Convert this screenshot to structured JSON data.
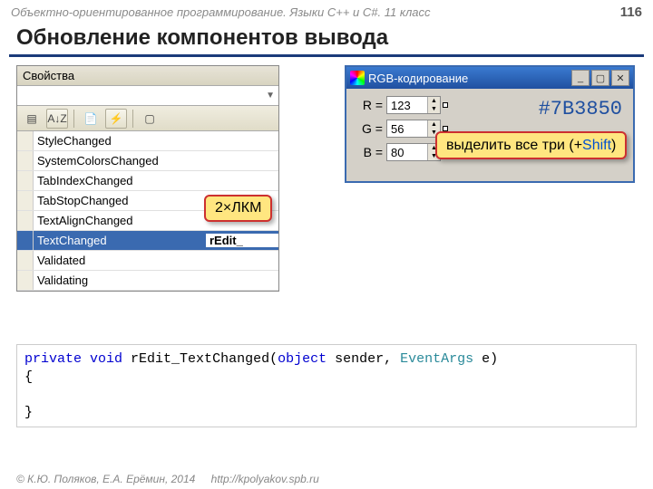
{
  "header": {
    "breadcrumb": "Объектно-ориентированное программирование. Языки C++ и C#. 11 класс",
    "page_num": "116"
  },
  "title": "Обновление компонентов вывода",
  "footer": {
    "copyright": "© К.Ю. Поляков, Е.А. Ерёмин, 2014",
    "url": "http://kpolyakov.spb.ru"
  },
  "props_panel": {
    "title": "Свойства",
    "toolbar": {
      "sort_az": "A↓Z",
      "lightning": "⚡"
    },
    "items": [
      {
        "name": "StyleChanged",
        "val": ""
      },
      {
        "name": "SystemColorsChanged",
        "val": ""
      },
      {
        "name": "TabIndexChanged",
        "val": ""
      },
      {
        "name": "TabStopChanged",
        "val": ""
      },
      {
        "name": "TextAlignChanged",
        "val": ""
      },
      {
        "name": "TextChanged",
        "val": "rEdit_",
        "selected": true
      },
      {
        "name": "Validated",
        "val": ""
      },
      {
        "name": "Validating",
        "val": ""
      }
    ]
  },
  "rgb_window": {
    "title": "RGB-кодирование",
    "rows": [
      {
        "label": "R =",
        "value": "123"
      },
      {
        "label": "G =",
        "value": "56"
      },
      {
        "label": "B =",
        "value": "80"
      }
    ],
    "hex": "#7B3850"
  },
  "callouts": {
    "dblclick": "2×ЛКМ",
    "select_all_pre": "выделить все три (+",
    "select_all_shift": "Shift",
    "select_all_post": ")"
  },
  "code": {
    "kw_private": "private",
    "kw_void": "void",
    "fn": " rEdit_TextChanged(",
    "kw_object": "object",
    "sender": " sender, ",
    "typ_eventargs": "EventArgs",
    "e_close": " e)",
    "brace_open": "{",
    "brace_close": "}"
  }
}
